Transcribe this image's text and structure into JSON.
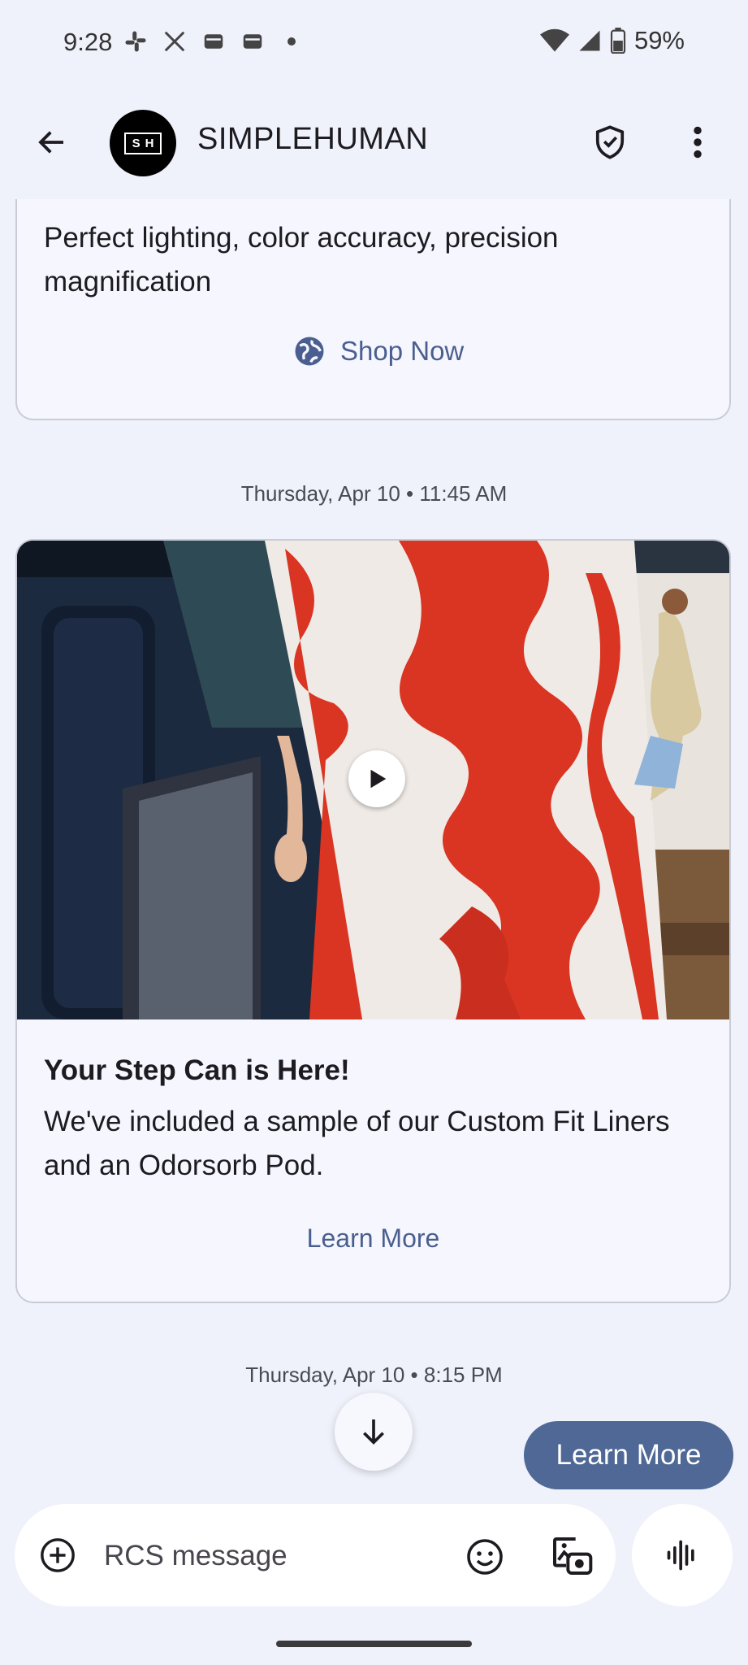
{
  "status": {
    "time": "9:28",
    "battery": "59%",
    "icons": [
      "slack-icon",
      "x-icon",
      "inbox-icon",
      "inbox-icon",
      "dot-icon",
      "wifi-icon",
      "signal-icon",
      "battery-icon"
    ]
  },
  "header": {
    "avatar_text": "SH",
    "contact_name": "SIMPLEHUMAN"
  },
  "messages": {
    "card1": {
      "body": "Perfect lighting, color accuracy, precision magnification",
      "action": "Shop Now"
    },
    "timestamp1": "Thursday, Apr 10 • 11:45 AM",
    "card2": {
      "title": "Your Step Can is Here!",
      "body": "We've included a sample of our Custom Fit Liners and an Odorsorb Pod.",
      "action": "Learn More"
    },
    "timestamp2": "Thursday, Apr 10 • 8:15 PM"
  },
  "suggestion_chip": "Learn More",
  "compose": {
    "placeholder": "RCS message"
  },
  "colors": {
    "background": "#eff1fb",
    "card": "#f6f7fe",
    "accent": "#4a5e8f",
    "chip": "#4f6896"
  }
}
